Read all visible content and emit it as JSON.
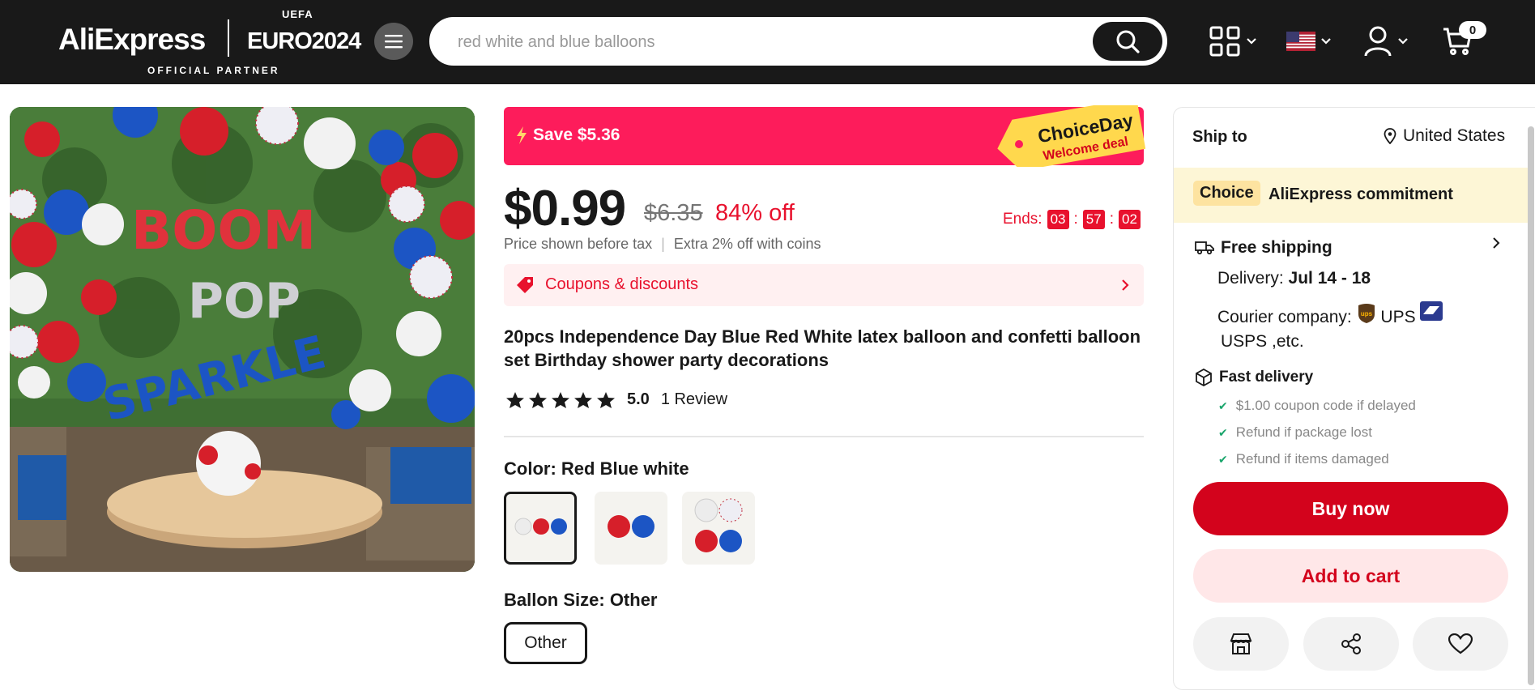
{
  "header": {
    "logo_text": "AliExpress",
    "partner_logo": "EURO2024",
    "partner_uefa": "UEFA",
    "partner_tag": "OFFICIAL PARTNER",
    "search_value": "red white and blue balloons",
    "cart_count": "0"
  },
  "deal": {
    "save_text": "Save $5.36",
    "tag_line1": "ChoiceDay",
    "tag_line2": "Welcome deal",
    "price": "$0.99",
    "old_price": "$6.35",
    "discount": "84% off",
    "ends_label": "Ends:",
    "hours": "03",
    "minutes": "57",
    "seconds": "02",
    "tax_note": "Price shown before tax",
    "coins_note": "Extra 2% off with coins",
    "coupons_label": "Coupons & discounts"
  },
  "product": {
    "title": "20pcs Independence Day Blue Red White latex balloon and confetti balloon set Birthday shower party decorations",
    "rating": "5.0",
    "reviews": "1 Review",
    "color_label": "Color:",
    "color_value": "Red Blue white",
    "size_label": "Ballon Size:",
    "size_value": "Other",
    "size_option": "Other",
    "banner_words": [
      "BOOM",
      "POP",
      "SPARKLE"
    ]
  },
  "shipping": {
    "ship_to_label": "Ship to",
    "ship_to_value": "United States",
    "choice_badge": "Choice",
    "commitment": "AliExpress commitment",
    "free_shipping": "Free shipping",
    "delivery_label": "Delivery:",
    "delivery_value": "Jul 14 - 18",
    "courier_label": "Courier company:",
    "courier_ups": "UPS",
    "courier_rest": "USPS ,etc.",
    "fast_delivery": "Fast delivery",
    "guarantees": [
      "$1.00 coupon code if delayed",
      "Refund if package lost",
      "Refund if items damaged"
    ],
    "buy_now": "Buy now",
    "add_to_cart": "Add to cart"
  },
  "colors": {
    "accent_red": "#d3031c",
    "banner_pink": "#fd1c5b",
    "header_bg": "#191919"
  }
}
